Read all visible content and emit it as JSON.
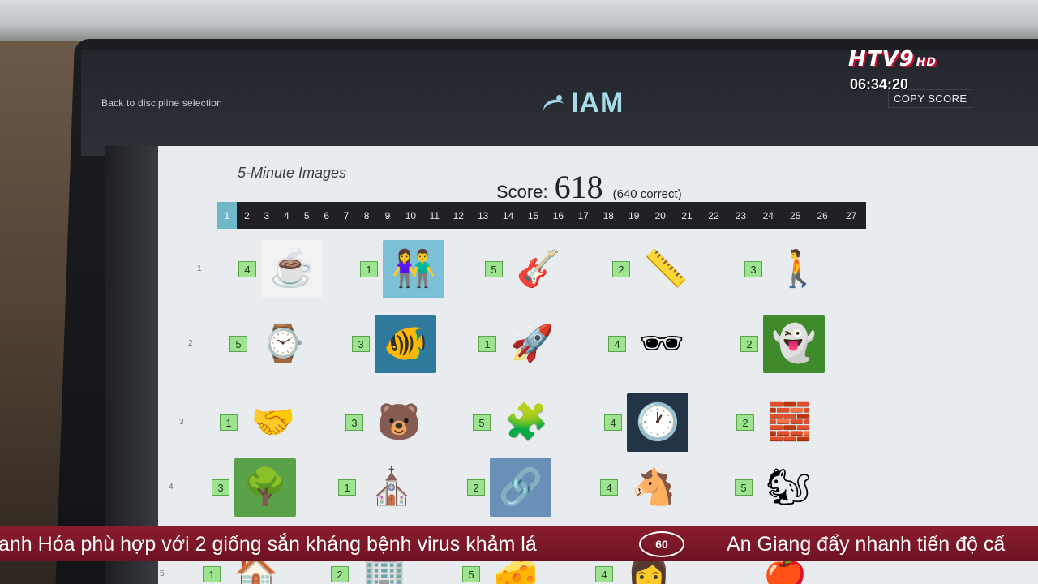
{
  "header": {
    "back_link": "Back to discipline selection",
    "logo_text": "IAM",
    "copy_score": "COPY SCORE"
  },
  "channel": {
    "logo": "HTV9",
    "hd": "HD",
    "time": "06:34:20"
  },
  "app": {
    "title": "5-Minute Images",
    "score_label": "Score:",
    "score_value": "618",
    "score_correct": "(640 correct)",
    "tabs": [
      "1",
      "2",
      "3",
      "4",
      "5",
      "6",
      "7",
      "8",
      "9",
      "10",
      "11",
      "12",
      "13",
      "14",
      "15",
      "16",
      "17",
      "18",
      "19",
      "20",
      "21",
      "22",
      "23",
      "24",
      "25",
      "26",
      "27"
    ],
    "active_tab_index": 0,
    "rows": [
      {
        "number": "1",
        "cells": [
          {
            "answer": "4",
            "image": "coffee-cup",
            "glyph": "☕",
            "bg": "#f2f2f2"
          },
          {
            "answer": "1",
            "image": "cartoon-people",
            "glyph": "👫",
            "bg": "#7cc0d8"
          },
          {
            "answer": "5",
            "image": "guitar",
            "glyph": "🎸",
            "bg": "#e9ecef"
          },
          {
            "answer": "2",
            "image": "ruler",
            "glyph": "📏",
            "bg": "#e9ecef"
          },
          {
            "answer": "3",
            "image": "man-with-stroller",
            "glyph": "🚶",
            "bg": "#e9ecef"
          }
        ]
      },
      {
        "number": "2",
        "cells": [
          {
            "answer": "5",
            "image": "pocket-watch",
            "glyph": "⌚",
            "bg": "#e9ecef"
          },
          {
            "answer": "3",
            "image": "goldfish",
            "glyph": "🐠",
            "bg": "#2f7a9c"
          },
          {
            "answer": "1",
            "image": "rocket",
            "glyph": "🚀",
            "bg": "#e9ecef"
          },
          {
            "answer": "4",
            "image": "sunglasses",
            "glyph": "🕶",
            "bg": "#e9ecef"
          },
          {
            "answer": "2",
            "image": "ghost",
            "glyph": "👻",
            "bg": "#3f8a2a"
          }
        ]
      },
      {
        "number": "3",
        "cells": [
          {
            "answer": "1",
            "image": "figures-handshake",
            "glyph": "🤝",
            "bg": "#e9ecef"
          },
          {
            "answer": "3",
            "image": "brown-bear",
            "glyph": "🐻",
            "bg": "#e9ecef"
          },
          {
            "answer": "5",
            "image": "puzzle-pieces",
            "glyph": "🧩",
            "bg": "#e9ecef"
          },
          {
            "answer": "4",
            "image": "clock-man",
            "glyph": "🕐",
            "bg": "#223445"
          },
          {
            "answer": "2",
            "image": "figure-pushing-wall",
            "glyph": "🧱",
            "bg": "#e9ecef"
          }
        ]
      },
      {
        "number": "4",
        "cells": [
          {
            "answer": "3",
            "image": "garden-arch",
            "glyph": "🌳",
            "bg": "#5aa24a"
          },
          {
            "answer": "1",
            "image": "cathedral-silhouette",
            "glyph": "⛪",
            "bg": "#e9ecef"
          },
          {
            "answer": "2",
            "image": "chain-link",
            "glyph": "🔗",
            "bg": "#6b90b8"
          },
          {
            "answer": "4",
            "image": "rocking-horse",
            "glyph": "🐴",
            "bg": "#e9ecef"
          },
          {
            "answer": "5",
            "image": "squirrel",
            "glyph": "🐿",
            "bg": "#e9ecef"
          }
        ]
      },
      {
        "number": "5",
        "cells": [
          {
            "answer": "1",
            "image": "house",
            "glyph": "🏠",
            "bg": "#e9ecef"
          },
          {
            "answer": "2",
            "image": "building",
            "glyph": "🏢",
            "bg": "#e9ecef"
          },
          {
            "answer": "5",
            "image": "cheese",
            "glyph": "🧀",
            "bg": "#e9ecef"
          },
          {
            "answer": "4",
            "image": "person",
            "glyph": "👩",
            "bg": "#e9ecef"
          },
          {
            "answer": "",
            "image": "apples",
            "glyph": "🍎",
            "bg": "#e9ecef"
          }
        ]
      }
    ]
  },
  "ticker": {
    "left_text": "anh Hóa phù hợp với 2 giống sắn kháng bệnh virus khảm lá",
    "emblem": "60",
    "right_text": "An Giang đẩy nhanh tiến độ cấ"
  }
}
